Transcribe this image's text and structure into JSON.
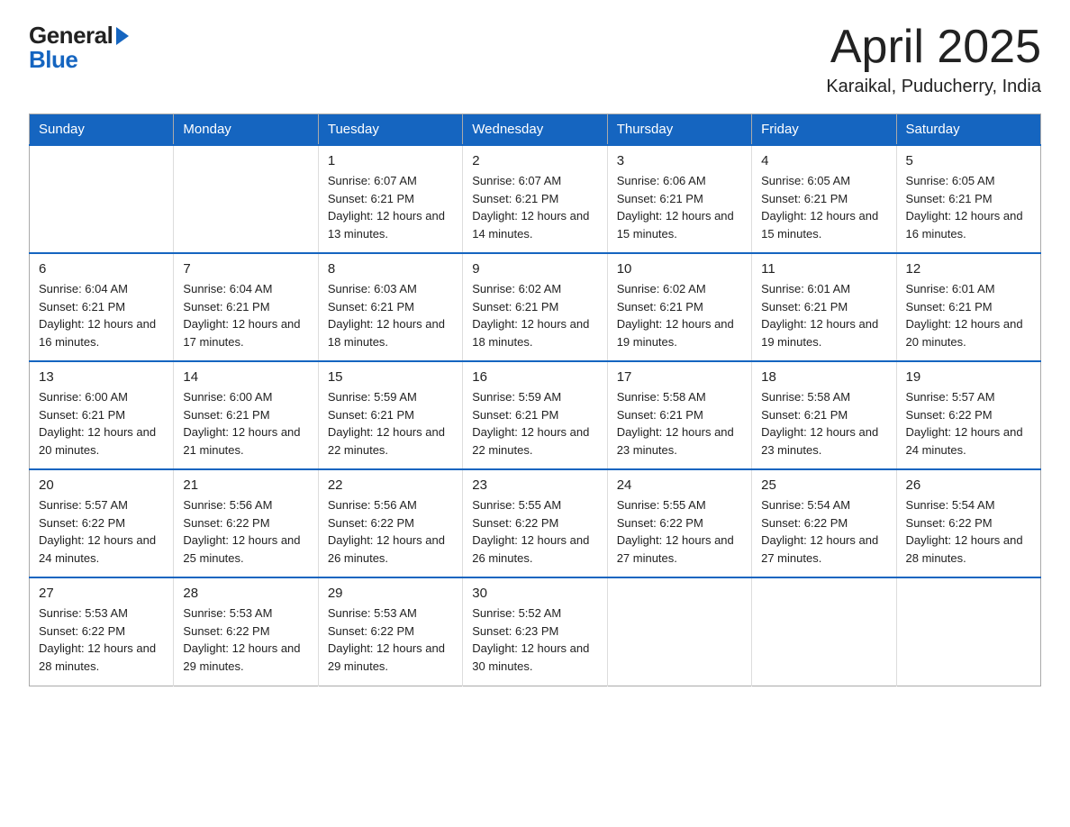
{
  "header": {
    "logo_general": "General",
    "logo_blue": "Blue",
    "month_title": "April 2025",
    "location": "Karaikal, Puducherry, India"
  },
  "days_of_week": [
    "Sunday",
    "Monday",
    "Tuesday",
    "Wednesday",
    "Thursday",
    "Friday",
    "Saturday"
  ],
  "weeks": [
    [
      {
        "day": "",
        "sunrise": "",
        "sunset": "",
        "daylight": ""
      },
      {
        "day": "",
        "sunrise": "",
        "sunset": "",
        "daylight": ""
      },
      {
        "day": "1",
        "sunrise": "Sunrise: 6:07 AM",
        "sunset": "Sunset: 6:21 PM",
        "daylight": "Daylight: 12 hours and 13 minutes."
      },
      {
        "day": "2",
        "sunrise": "Sunrise: 6:07 AM",
        "sunset": "Sunset: 6:21 PM",
        "daylight": "Daylight: 12 hours and 14 minutes."
      },
      {
        "day": "3",
        "sunrise": "Sunrise: 6:06 AM",
        "sunset": "Sunset: 6:21 PM",
        "daylight": "Daylight: 12 hours and 15 minutes."
      },
      {
        "day": "4",
        "sunrise": "Sunrise: 6:05 AM",
        "sunset": "Sunset: 6:21 PM",
        "daylight": "Daylight: 12 hours and 15 minutes."
      },
      {
        "day": "5",
        "sunrise": "Sunrise: 6:05 AM",
        "sunset": "Sunset: 6:21 PM",
        "daylight": "Daylight: 12 hours and 16 minutes."
      }
    ],
    [
      {
        "day": "6",
        "sunrise": "Sunrise: 6:04 AM",
        "sunset": "Sunset: 6:21 PM",
        "daylight": "Daylight: 12 hours and 16 minutes."
      },
      {
        "day": "7",
        "sunrise": "Sunrise: 6:04 AM",
        "sunset": "Sunset: 6:21 PM",
        "daylight": "Daylight: 12 hours and 17 minutes."
      },
      {
        "day": "8",
        "sunrise": "Sunrise: 6:03 AM",
        "sunset": "Sunset: 6:21 PM",
        "daylight": "Daylight: 12 hours and 18 minutes."
      },
      {
        "day": "9",
        "sunrise": "Sunrise: 6:02 AM",
        "sunset": "Sunset: 6:21 PM",
        "daylight": "Daylight: 12 hours and 18 minutes."
      },
      {
        "day": "10",
        "sunrise": "Sunrise: 6:02 AM",
        "sunset": "Sunset: 6:21 PM",
        "daylight": "Daylight: 12 hours and 19 minutes."
      },
      {
        "day": "11",
        "sunrise": "Sunrise: 6:01 AM",
        "sunset": "Sunset: 6:21 PM",
        "daylight": "Daylight: 12 hours and 19 minutes."
      },
      {
        "day": "12",
        "sunrise": "Sunrise: 6:01 AM",
        "sunset": "Sunset: 6:21 PM",
        "daylight": "Daylight: 12 hours and 20 minutes."
      }
    ],
    [
      {
        "day": "13",
        "sunrise": "Sunrise: 6:00 AM",
        "sunset": "Sunset: 6:21 PM",
        "daylight": "Daylight: 12 hours and 20 minutes."
      },
      {
        "day": "14",
        "sunrise": "Sunrise: 6:00 AM",
        "sunset": "Sunset: 6:21 PM",
        "daylight": "Daylight: 12 hours and 21 minutes."
      },
      {
        "day": "15",
        "sunrise": "Sunrise: 5:59 AM",
        "sunset": "Sunset: 6:21 PM",
        "daylight": "Daylight: 12 hours and 22 minutes."
      },
      {
        "day": "16",
        "sunrise": "Sunrise: 5:59 AM",
        "sunset": "Sunset: 6:21 PM",
        "daylight": "Daylight: 12 hours and 22 minutes."
      },
      {
        "day": "17",
        "sunrise": "Sunrise: 5:58 AM",
        "sunset": "Sunset: 6:21 PM",
        "daylight": "Daylight: 12 hours and 23 minutes."
      },
      {
        "day": "18",
        "sunrise": "Sunrise: 5:58 AM",
        "sunset": "Sunset: 6:21 PM",
        "daylight": "Daylight: 12 hours and 23 minutes."
      },
      {
        "day": "19",
        "sunrise": "Sunrise: 5:57 AM",
        "sunset": "Sunset: 6:22 PM",
        "daylight": "Daylight: 12 hours and 24 minutes."
      }
    ],
    [
      {
        "day": "20",
        "sunrise": "Sunrise: 5:57 AM",
        "sunset": "Sunset: 6:22 PM",
        "daylight": "Daylight: 12 hours and 24 minutes."
      },
      {
        "day": "21",
        "sunrise": "Sunrise: 5:56 AM",
        "sunset": "Sunset: 6:22 PM",
        "daylight": "Daylight: 12 hours and 25 minutes."
      },
      {
        "day": "22",
        "sunrise": "Sunrise: 5:56 AM",
        "sunset": "Sunset: 6:22 PM",
        "daylight": "Daylight: 12 hours and 26 minutes."
      },
      {
        "day": "23",
        "sunrise": "Sunrise: 5:55 AM",
        "sunset": "Sunset: 6:22 PM",
        "daylight": "Daylight: 12 hours and 26 minutes."
      },
      {
        "day": "24",
        "sunrise": "Sunrise: 5:55 AM",
        "sunset": "Sunset: 6:22 PM",
        "daylight": "Daylight: 12 hours and 27 minutes."
      },
      {
        "day": "25",
        "sunrise": "Sunrise: 5:54 AM",
        "sunset": "Sunset: 6:22 PM",
        "daylight": "Daylight: 12 hours and 27 minutes."
      },
      {
        "day": "26",
        "sunrise": "Sunrise: 5:54 AM",
        "sunset": "Sunset: 6:22 PM",
        "daylight": "Daylight: 12 hours and 28 minutes."
      }
    ],
    [
      {
        "day": "27",
        "sunrise": "Sunrise: 5:53 AM",
        "sunset": "Sunset: 6:22 PM",
        "daylight": "Daylight: 12 hours and 28 minutes."
      },
      {
        "day": "28",
        "sunrise": "Sunrise: 5:53 AM",
        "sunset": "Sunset: 6:22 PM",
        "daylight": "Daylight: 12 hours and 29 minutes."
      },
      {
        "day": "29",
        "sunrise": "Sunrise: 5:53 AM",
        "sunset": "Sunset: 6:22 PM",
        "daylight": "Daylight: 12 hours and 29 minutes."
      },
      {
        "day": "30",
        "sunrise": "Sunrise: 5:52 AM",
        "sunset": "Sunset: 6:23 PM",
        "daylight": "Daylight: 12 hours and 30 minutes."
      },
      {
        "day": "",
        "sunrise": "",
        "sunset": "",
        "daylight": ""
      },
      {
        "day": "",
        "sunrise": "",
        "sunset": "",
        "daylight": ""
      },
      {
        "day": "",
        "sunrise": "",
        "sunset": "",
        "daylight": ""
      }
    ]
  ]
}
